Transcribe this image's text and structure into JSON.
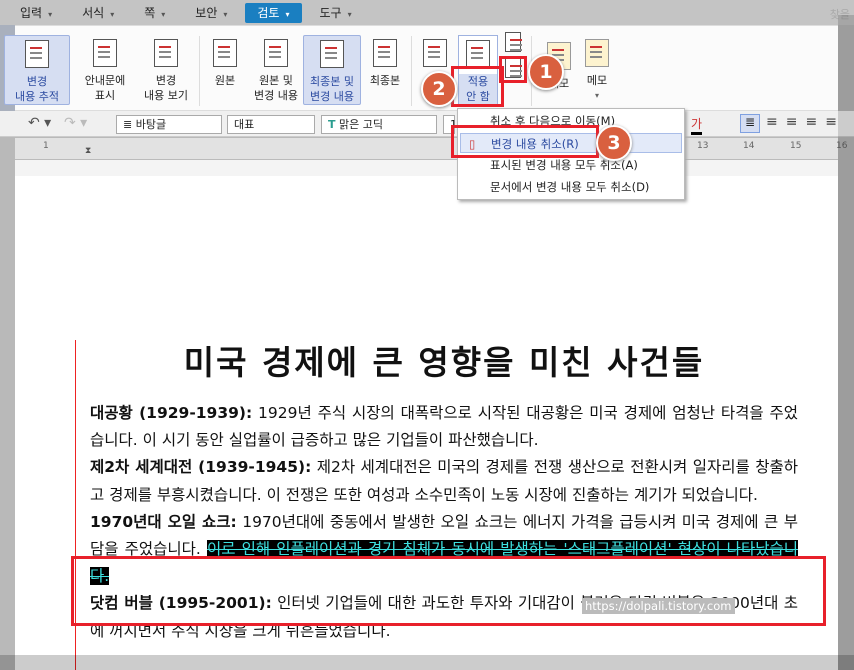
{
  "menu": {
    "items": [
      "입력",
      "서식",
      "쪽",
      "보안",
      "검토",
      "도구"
    ],
    "active": "검토",
    "find": "찾을"
  },
  "ribbon": {
    "track": "변경\n내용 추적",
    "balloon": "안내문에\n표시",
    "view": "변경\n내용 보기",
    "original": "원본",
    "original_changes": "원본 및\n변경 내용",
    "final_changes": "최종본 및\n변경 내용",
    "final": "최종본",
    "reject": "적용\n안 함",
    "memo1": "메모",
    "memo2": "메모"
  },
  "toolbar": {
    "style": "바탕글",
    "lang": "대표",
    "font": "맑은 고딕",
    "size": "1"
  },
  "ruler": [
    "1",
    "13",
    "14",
    "15",
    "16"
  ],
  "dropdown": {
    "items": [
      "취소 후 다음으로 이동(M)",
      "변경 내용 취소(R)",
      "표시된 변경 내용 모두 취소(A)",
      "문서에서 변경 내용 모두 취소(D)"
    ]
  },
  "badges": [
    "1",
    "2",
    "3"
  ],
  "doc": {
    "title": "미국 경제에 큰 영향을 미친 사건들",
    "p1_head": "대공황 (1929-1939):",
    "p1": " 1929년 주식 시장의 대폭락으로 시작된 대공황은 미국 경제에 엄청난 타격을 주었습니다. 이 시기 동안 실업률이 급증하고 많은 기업들이 파산했습니다.",
    "p2_head": "제2차 세계대전 (1939-1945):",
    "p2": " 제2차 세계대전은 미국의 경제를 전쟁 생산으로 전환시켜 일자리를 창출하고 경제를 부흥시켰습니다. 이 전쟁은 또한 여성과 소수민족이 노동 시장에 진출하는 계기가 되었습니다.",
    "p3_head": "1970년대 오일 쇼크:",
    "p3": " 1970년대에 중동에서 발생한 오일 쇼크는 에너지 가격을 급등시켜 미국 경제에 큰 부담을 주었습니다. ",
    "p3_inserted": "이로 인해 인플레이션과 경기 침체가 동시에 발생하는 '스태그플레이션' 현상이 나타났습니다.",
    "p4_head": "닷컴 버블 (1995-2001):",
    "p4": " 인터넷 기업들에 대한 과도한 투자와 기대감이 불러온 닷컴 버블은 2000년대 초에 꺼지면서 주식 시장을 크게 뒤흔들었습니다."
  },
  "watermark": "https://dolpali.tistory.com",
  "colors": {
    "accent": "#1a7fc1",
    "highlight_box": "#e8202a",
    "badge": "#d9603f",
    "inserted_text": "#3ee0e0"
  }
}
